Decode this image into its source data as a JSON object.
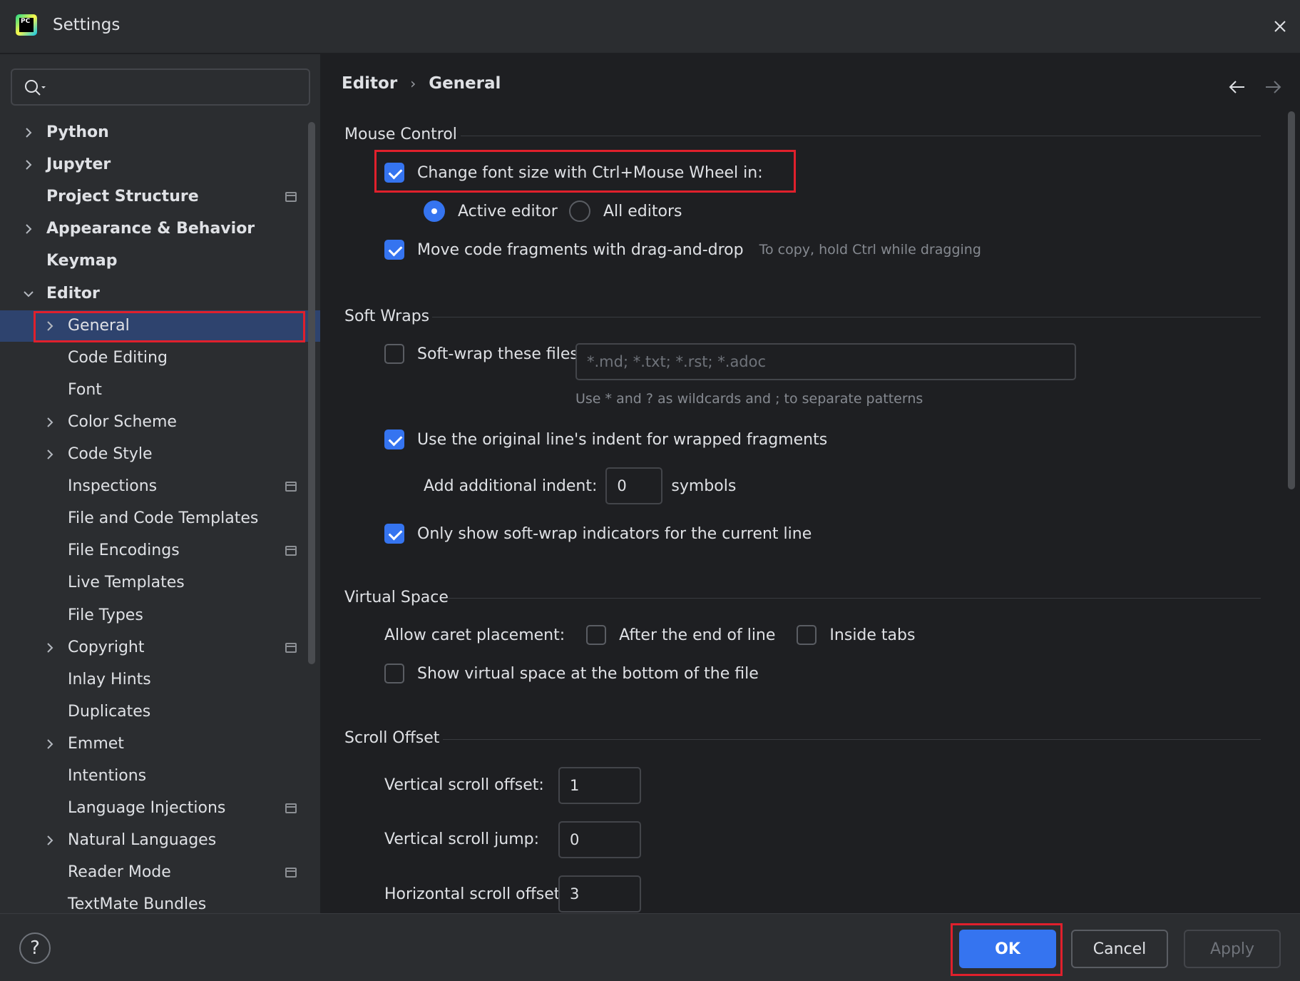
{
  "window": {
    "title": "Settings",
    "logo_text": "PC"
  },
  "sidebar": {
    "search_placeholder": "",
    "items": [
      {
        "label": "Python",
        "level": 0,
        "expandable": true,
        "expanded": false,
        "bold": true,
        "project_icon": false
      },
      {
        "label": "Jupyter",
        "level": 0,
        "expandable": true,
        "expanded": false,
        "bold": true,
        "project_icon": false
      },
      {
        "label": "Project Structure",
        "level": 0,
        "expandable": false,
        "bold": true,
        "project_icon": true
      },
      {
        "label": "Appearance & Behavior",
        "level": 0,
        "expandable": true,
        "expanded": false,
        "bold": true,
        "project_icon": false
      },
      {
        "label": "Keymap",
        "level": 0,
        "expandable": false,
        "bold": true,
        "project_icon": false
      },
      {
        "label": "Editor",
        "level": 0,
        "expandable": true,
        "expanded": true,
        "bold": true,
        "project_icon": false
      },
      {
        "label": "General",
        "level": 1,
        "expandable": true,
        "expanded": false,
        "selected": true,
        "project_icon": false
      },
      {
        "label": "Code Editing",
        "level": 1,
        "expandable": false,
        "project_icon": false
      },
      {
        "label": "Font",
        "level": 1,
        "expandable": false,
        "project_icon": false
      },
      {
        "label": "Color Scheme",
        "level": 1,
        "expandable": true,
        "expanded": false,
        "project_icon": false
      },
      {
        "label": "Code Style",
        "level": 1,
        "expandable": true,
        "expanded": false,
        "project_icon": false
      },
      {
        "label": "Inspections",
        "level": 1,
        "expandable": false,
        "project_icon": true
      },
      {
        "label": "File and Code Templates",
        "level": 1,
        "expandable": false,
        "project_icon": false
      },
      {
        "label": "File Encodings",
        "level": 1,
        "expandable": false,
        "project_icon": true
      },
      {
        "label": "Live Templates",
        "level": 1,
        "expandable": false,
        "project_icon": false
      },
      {
        "label": "File Types",
        "level": 1,
        "expandable": false,
        "project_icon": false
      },
      {
        "label": "Copyright",
        "level": 1,
        "expandable": true,
        "expanded": false,
        "project_icon": true
      },
      {
        "label": "Inlay Hints",
        "level": 1,
        "expandable": false,
        "project_icon": false
      },
      {
        "label": "Duplicates",
        "level": 1,
        "expandable": false,
        "project_icon": false
      },
      {
        "label": "Emmet",
        "level": 1,
        "expandable": true,
        "expanded": false,
        "project_icon": false
      },
      {
        "label": "Intentions",
        "level": 1,
        "expandable": false,
        "project_icon": false
      },
      {
        "label": "Language Injections",
        "level": 1,
        "expandable": false,
        "project_icon": true
      },
      {
        "label": "Natural Languages",
        "level": 1,
        "expandable": true,
        "expanded": false,
        "project_icon": false
      },
      {
        "label": "Reader Mode",
        "level": 1,
        "expandable": false,
        "project_icon": true
      },
      {
        "label": "TextMate Bundles",
        "level": 1,
        "expandable": false,
        "project_icon": false
      }
    ]
  },
  "breadcrumb": {
    "parent": "Editor",
    "separator": "›",
    "current": "General"
  },
  "mouse_control": {
    "title": "Mouse Control",
    "change_font_size": {
      "label": "Change font size with Ctrl+Mouse Wheel in:",
      "checked": true
    },
    "active_editor": {
      "label": "Active editor",
      "selected": true
    },
    "all_editors": {
      "label": "All editors",
      "selected": false
    },
    "move_code": {
      "label": "Move code fragments with drag-and-drop",
      "checked": true,
      "hint": "To copy, hold Ctrl while dragging"
    }
  },
  "soft_wraps": {
    "title": "Soft Wraps",
    "soft_wrap_files": {
      "label": "Soft-wrap these files:",
      "checked": false,
      "placeholder": "*.md; *.txt; *.rst; *.adoc",
      "hint": "Use * and ? as wildcards and ; to separate patterns"
    },
    "original_indent": {
      "label": "Use the original line's indent for wrapped fragments",
      "checked": true
    },
    "additional_indent": {
      "label": "Add additional indent:",
      "value": "0",
      "unit": "symbols"
    },
    "only_current_line": {
      "label": "Only show soft-wrap indicators for the current line",
      "checked": true
    }
  },
  "virtual_space": {
    "title": "Virtual Space",
    "caret_label": "Allow caret placement:",
    "after_end": {
      "label": "After the end of line",
      "checked": false
    },
    "inside_tabs": {
      "label": "Inside tabs",
      "checked": false
    },
    "show_virtual": {
      "label": "Show virtual space at the bottom of the file",
      "checked": false
    }
  },
  "scroll_offset": {
    "title": "Scroll Offset",
    "vertical_offset": {
      "label": "Vertical scroll offset:",
      "value": "1"
    },
    "vertical_jump": {
      "label": "Vertical scroll jump:",
      "value": "0"
    },
    "horizontal_offset": {
      "label": "Horizontal scroll offset:",
      "value": "3"
    }
  },
  "footer": {
    "help": "?",
    "ok": "OK",
    "cancel": "Cancel",
    "apply": "Apply"
  },
  "colors": {
    "accent": "#3574f0",
    "highlight": "#e0202c",
    "selection": "#2e436e",
    "panel": "#2b2d30",
    "background": "#1e1f22"
  }
}
